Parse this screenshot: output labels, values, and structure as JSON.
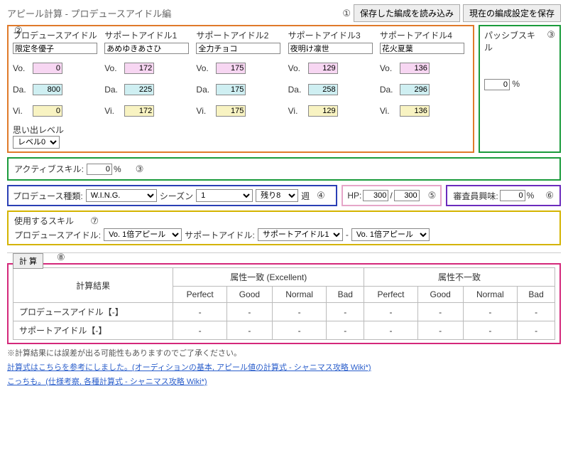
{
  "title": "アピール計算 - プロデュースアイドル編",
  "buttons": {
    "load": "保存した編成を読み込み",
    "save": "現在の編成設定を保存"
  },
  "markers": {
    "m1": "①",
    "m2": "②",
    "m3": "③",
    "m4": "④",
    "m5": "⑤",
    "m6": "⑥",
    "m7": "⑦",
    "m8": "⑧"
  },
  "idolPanel": {
    "cols": [
      {
        "head": "プロデュースアイドル",
        "name": "限定冬優子",
        "vo": "0",
        "da": "800",
        "vi": "0"
      },
      {
        "head": "サポートアイドル1",
        "name": "あめゆきあさひ",
        "vo": "172",
        "da": "225",
        "vi": "172"
      },
      {
        "head": "サポートアイドル2",
        "name": "全力チョコ",
        "vo": "175",
        "da": "175",
        "vi": "175"
      },
      {
        "head": "サポートアイドル3",
        "name": "夜明け凛世",
        "vo": "129",
        "da": "258",
        "vi": "129"
      },
      {
        "head": "サポートアイドル4",
        "name": "花火夏葉",
        "vo": "136",
        "da": "296",
        "vi": "136"
      }
    ],
    "labels": {
      "vo": "Vo.",
      "da": "Da.",
      "vi": "Vi."
    },
    "omoide": {
      "label": "思い出レベル",
      "value": "レベル0"
    }
  },
  "passive": {
    "head": "パッシブスキル",
    "value": "0",
    "unit": "%"
  },
  "active": {
    "label": "アクティブスキル:",
    "value": "0",
    "unit": "%"
  },
  "produce": {
    "label": "プロデュース種類:",
    "type": "W.I.N.G.",
    "seasonLabel": "シーズン",
    "seasonValue": "1",
    "weekLabel": "残り8",
    "weekValue": "週"
  },
  "hp": {
    "label": "HP:",
    "cur": "300",
    "sep": "/",
    "max": "300"
  },
  "interest": {
    "label": "審査員興味:",
    "value": "0",
    "unit": "%"
  },
  "skill": {
    "head": "使用するスキル",
    "pLabel": "プロデュースアイドル:",
    "pValue": "Vo. 1倍アピール",
    "sLabel": "サポートアイドル:",
    "sIdolValue": "サポートアイドル1",
    "dash": "-",
    "sSkillValue": "Vo. 1倍アピール"
  },
  "calcBtn": "計 算",
  "resultTable": {
    "rowHead": "計算結果",
    "group1": "属性一致 (Excellent)",
    "group2": "属性不一致",
    "grades": [
      "Perfect",
      "Good",
      "Normal",
      "Bad"
    ],
    "rows": [
      {
        "label": "プロデュースアイドル【-】",
        "cells": [
          "-",
          "-",
          "-",
          "-",
          "-",
          "-",
          "-",
          "-"
        ]
      },
      {
        "label": "サポートアイドル【-】",
        "cells": [
          "-",
          "-",
          "-",
          "-",
          "-",
          "-",
          "-",
          "-"
        ]
      }
    ]
  },
  "footnotes": {
    "note": "※計算結果には誤差が出る可能性もありますのでご了承ください。",
    "link1": "計算式はこちらを参考にしました。(オーディションの基本, アピール値の計算式 - シャニマス攻略 Wiki*)",
    "link2": "こっちも。(仕様考察, 各種計算式 - シャニマス攻略 Wiki*)"
  }
}
